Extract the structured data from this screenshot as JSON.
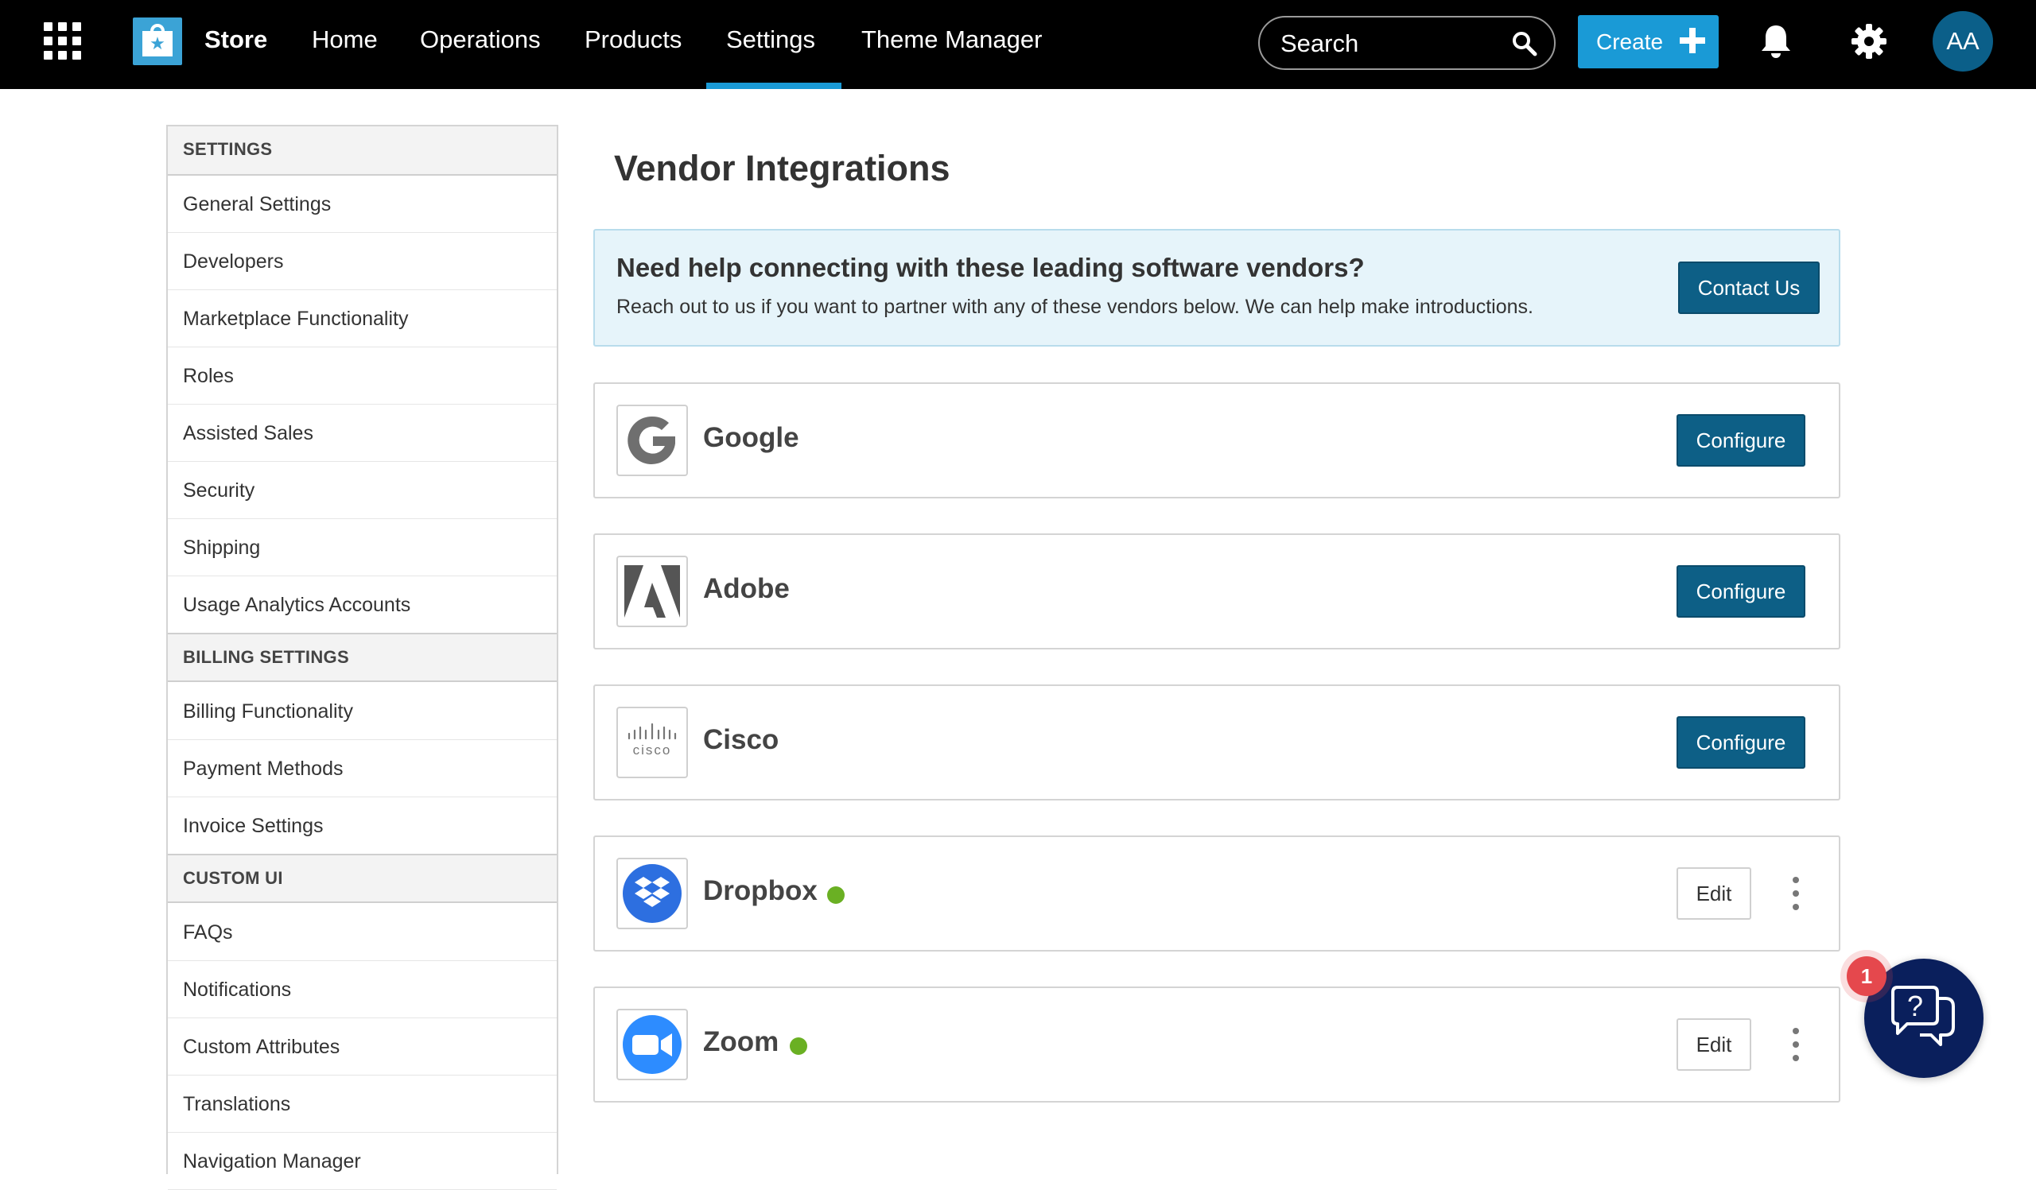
{
  "header": {
    "brand": "Store",
    "nav": [
      {
        "label": "Home"
      },
      {
        "label": "Operations"
      },
      {
        "label": "Products"
      },
      {
        "label": "Settings",
        "active": true
      },
      {
        "label": "Theme Manager"
      }
    ],
    "search_placeholder": "Search",
    "create_label": "Create",
    "avatar_initials": "AA",
    "accent_color": "#1a9ad6"
  },
  "sidebar": {
    "sections": [
      {
        "title": "SETTINGS",
        "items": [
          "General Settings",
          "Developers",
          "Marketplace Functionality",
          "Roles",
          "Assisted Sales",
          "Security",
          "Shipping",
          "Usage Analytics Accounts"
        ]
      },
      {
        "title": "BILLING SETTINGS",
        "items": [
          "Billing Functionality",
          "Payment Methods",
          "Invoice Settings"
        ]
      },
      {
        "title": "CUSTOM UI",
        "items": [
          "FAQs",
          "Notifications",
          "Custom Attributes",
          "Translations",
          "Navigation Manager"
        ]
      }
    ]
  },
  "main": {
    "title": "Vendor Integrations",
    "banner": {
      "title": "Need help connecting with these leading software vendors?",
      "text": "Reach out to us if you want to partner with any of these vendors below. We can help make introductions.",
      "button": "Contact Us"
    },
    "vendors": [
      {
        "name": "Google",
        "action": "Configure",
        "connected": false,
        "icon": "google-logo-icon"
      },
      {
        "name": "Adobe",
        "action": "Configure",
        "connected": false,
        "icon": "adobe-logo-icon"
      },
      {
        "name": "Cisco",
        "action": "Configure",
        "connected": false,
        "icon": "cisco-logo-icon"
      },
      {
        "name": "Dropbox",
        "action": "Edit",
        "connected": true,
        "icon": "dropbox-logo-icon"
      },
      {
        "name": "Zoom",
        "action": "Edit",
        "connected": true,
        "icon": "zoom-logo-icon"
      }
    ],
    "primary_button_color": "#0d5f86",
    "connected_color": "#6ab023"
  },
  "help_widget": {
    "badge_count": "1",
    "icon": "help-chat-icon"
  }
}
